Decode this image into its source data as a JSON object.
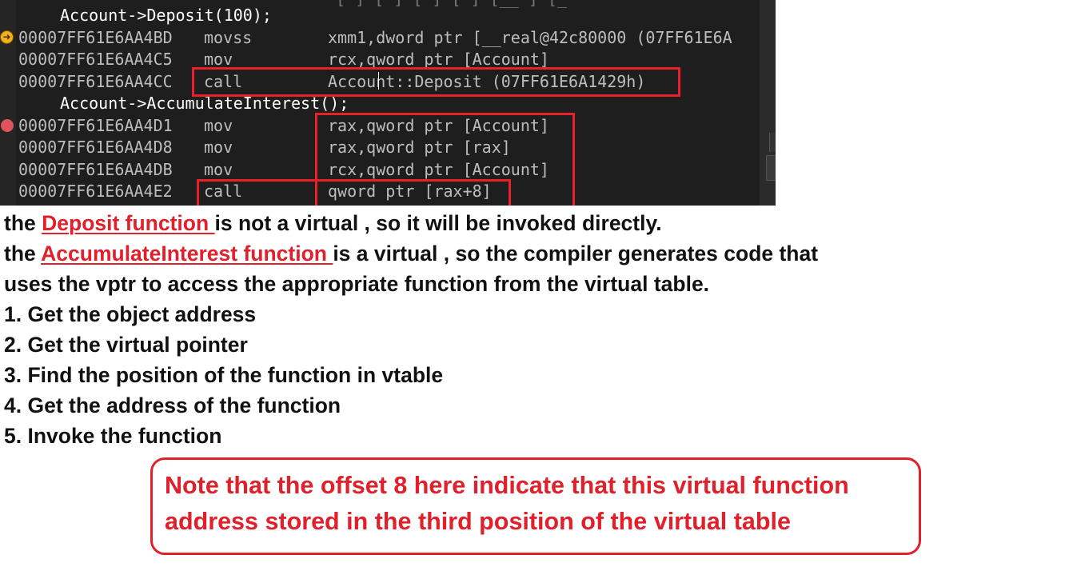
{
  "disassembly": {
    "truncated_top_line": "[  ]   [  ]   [  ]   [  ]   [__  ]   [_  ",
    "lines": [
      {
        "kind": "source",
        "text": "Account->Deposit(100);"
      },
      {
        "kind": "asm",
        "address": "00007FF61E6AA4BD",
        "mnemonic": "movss",
        "operands": "xmm1,dword ptr [__real@42c80000 (07FF61E6A"
      },
      {
        "kind": "asm",
        "address": "00007FF61E6AA4C5",
        "mnemonic": "mov",
        "operands": "rcx,qword ptr [Account]"
      },
      {
        "kind": "asm",
        "address": "00007FF61E6AA4CC",
        "mnemonic": "call",
        "operands": "Account::Deposit (07FF61E6A1429h)"
      },
      {
        "kind": "source",
        "text": "Account->AccumulateInterest();"
      },
      {
        "kind": "asm",
        "address": "00007FF61E6AA4D1",
        "mnemonic": "mov",
        "operands": "rax,qword ptr [Account]"
      },
      {
        "kind": "asm",
        "address": "00007FF61E6AA4D8",
        "mnemonic": "mov",
        "operands": "rax,qword ptr [rax]"
      },
      {
        "kind": "asm",
        "address": "00007FF61E6AA4DB",
        "mnemonic": "mov",
        "operands": "rcx,qword ptr [Account]"
      },
      {
        "kind": "asm",
        "address": "00007FF61E6AA4E2",
        "mnemonic": "call",
        "operands": "qword ptr [rax+8]"
      }
    ],
    "current_instruction_glyph": "➜",
    "colors": {
      "background": "#1e1e1e",
      "highlight_box": "#e8202a",
      "breakpoint": "#e0535c",
      "current_arrow": "#f2b01c"
    }
  },
  "explanation": {
    "p1_prefix": "the ",
    "p1_link": "Deposit function ",
    "p1_suffix": "is not a virtual , so it will be invoked directly.",
    "p2_prefix": "the ",
    "p2_link": "AccumulateInterest function ",
    "p2_suffix": "is a virtual , so the compiler generates code that",
    "p3": "uses the vptr to access the appropriate function from the virtual table.",
    "steps": [
      "1. Get the object address",
      "2. Get the virtual pointer",
      "3. Find the position of the function in vtable",
      "4. Get the address of the function",
      "5. Invoke the function"
    ],
    "link_color": "#e0202a"
  },
  "note": {
    "line1": "Note that the offset 8 here indicate that this virtual function",
    "line2": "address stored in the third position of the virtual table"
  }
}
